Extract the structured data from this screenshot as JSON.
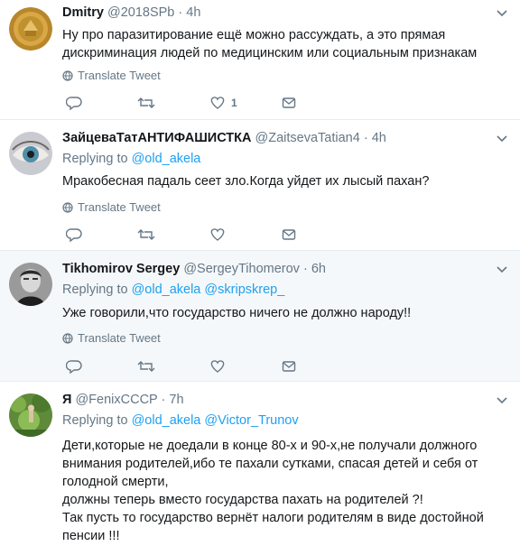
{
  "tweets": [
    {
      "name": "Dmitry",
      "handle": "@2018SPb",
      "dot": "·",
      "time": "4h",
      "replying_label": "",
      "mentions": [],
      "text": "Ну про паразитирование ещё можно рассуждать, а это прямая\nдискриминация людей по медицинским или социальным признакам",
      "translate": "Translate Tweet",
      "reply_count": "",
      "retweet_count": "",
      "like_count": "1"
    },
    {
      "name": "ЗайцеваТатАНТИФАШИСТКА",
      "handle": "@ZaitsevaTatian4",
      "dot": "·",
      "time": "4h",
      "replying_label": "Replying to",
      "mentions": [
        "@old_akela"
      ],
      "text": "Мракобесная падаль сеет зло.Когда уйдет их лысый пахан?",
      "translate": "Translate Tweet",
      "reply_count": "",
      "retweet_count": "",
      "like_count": ""
    },
    {
      "name": "Tikhomirov Sergey",
      "handle": "@SergeyTihomerov",
      "dot": "·",
      "time": "6h",
      "replying_label": "Replying to",
      "mentions": [
        "@old_akela",
        "@skripskrep_"
      ],
      "text": "Уже говорили,что государство ничего не должно народу!!",
      "translate": "Translate Tweet",
      "reply_count": "",
      "retweet_count": "",
      "like_count": ""
    },
    {
      "name": "Я",
      "handle": "@FenixCCCP",
      "dot": "·",
      "time": "7h",
      "replying_label": "Replying to",
      "mentions": [
        "@old_akela",
        "@Victor_Trunov"
      ],
      "text": "Дети,которые не доедали в конце 80-х и 90-х,не получали должного\nвнимания родителей,ибо те пахали сутками, спасая детей и себя от\nголодной смерти,\nдолжны теперь вместо государства пахать на родителей ?!\nТак пусть то государство вернёт налоги родителям в виде достойной\nпенсии !!!",
      "translate": "",
      "reply_count": "",
      "retweet_count": "",
      "like_count": ""
    }
  ],
  "colors": {
    "link": "#1da1f2",
    "secondary": "#657786",
    "highlight_bg": "#f5f8fa",
    "border": "#e6ecf0"
  },
  "icons": [
    "chevron-down-icon",
    "globe-icon",
    "reply-icon",
    "retweet-icon",
    "like-icon",
    "direct-message-icon"
  ]
}
